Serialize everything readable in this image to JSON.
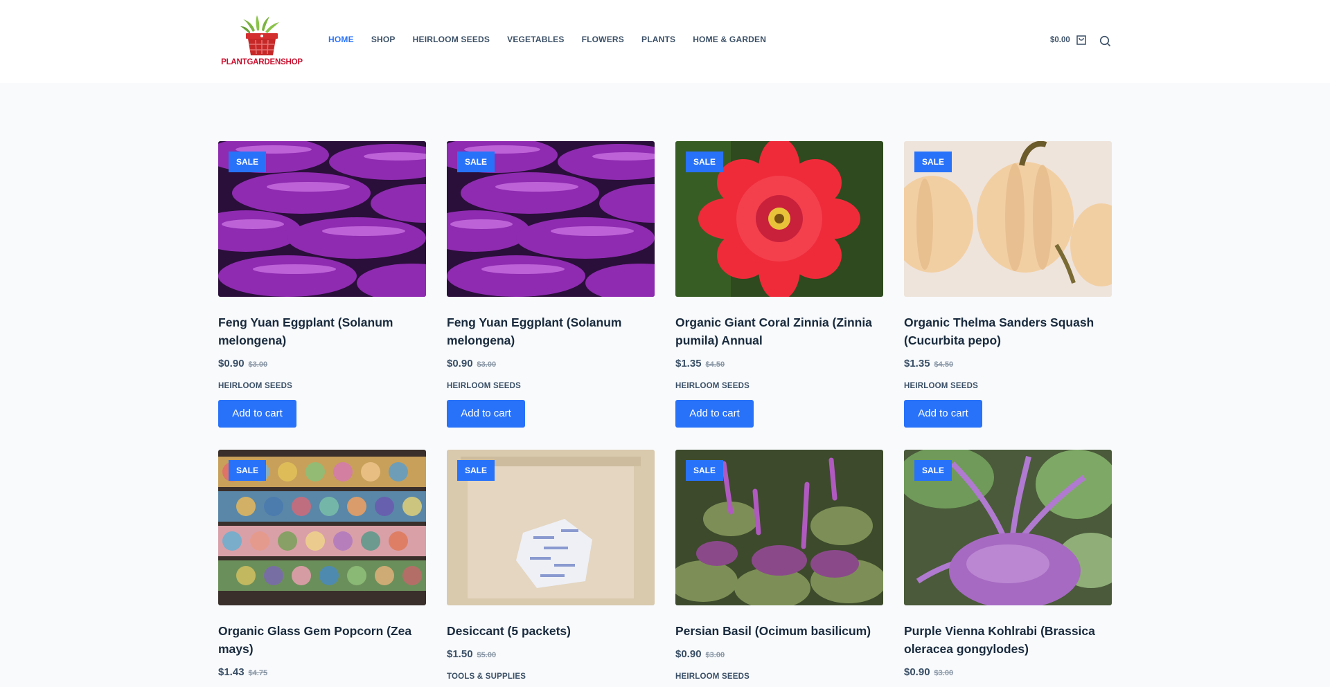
{
  "brand": {
    "name": "PLANTGARDENSHOP"
  },
  "nav": {
    "items": [
      {
        "label": "HOME",
        "active": true
      },
      {
        "label": "SHOP"
      },
      {
        "label": "HEIRLOOM SEEDS"
      },
      {
        "label": "VEGETABLES"
      },
      {
        "label": "FLOWERS"
      },
      {
        "label": "PLANTS"
      },
      {
        "label": "HOME & GARDEN"
      }
    ]
  },
  "header": {
    "cart_total": "$0.00",
    "cart_icon": "cart-icon",
    "search_icon": "search-icon"
  },
  "colors": {
    "accent": "#2872fa",
    "text": "#192a3d",
    "muted": "#3a4f66",
    "page_bg": "#f8fafc"
  },
  "products": [
    {
      "badge": "SALE",
      "title": "Feng Yuan Eggplant (Solanum melongena)",
      "price": "$0.90",
      "old_price": "$3.00",
      "category": "HEIRLOOM SEEDS",
      "button": "Add to cart"
    },
    {
      "badge": "SALE",
      "title": "Feng Yuan Eggplant (Solanum melongena)",
      "price": "$0.90",
      "old_price": "$3.00",
      "category": "HEIRLOOM SEEDS",
      "button": "Add to cart"
    },
    {
      "badge": "SALE",
      "title": "Organic Giant Coral Zinnia (Zinnia pumila) Annual",
      "price": "$1.35",
      "old_price": "$4.50",
      "category": "HEIRLOOM SEEDS",
      "button": "Add to cart"
    },
    {
      "badge": "SALE",
      "title": "Organic Thelma Sanders Squash (Cucurbita pepo)",
      "price": "$1.35",
      "old_price": "$4.50",
      "category": "HEIRLOOM SEEDS",
      "button": "Add to cart"
    },
    {
      "badge": "SALE",
      "title": "Organic Glass Gem Popcorn (Zea mays)",
      "price": "$1.43",
      "old_price": "$4.75",
      "category": "",
      "button": ""
    },
    {
      "badge": "SALE",
      "title": "Desiccant (5 packets)",
      "price": "$1.50",
      "old_price": "$5.00",
      "category": "TOOLS & SUPPLIES",
      "button": ""
    },
    {
      "badge": "SALE",
      "title": "Persian Basil (Ocimum basilicum)",
      "price": "$0.90",
      "old_price": "$3.00",
      "category": "HEIRLOOM SEEDS",
      "button": ""
    },
    {
      "badge": "SALE",
      "title": "Purple Vienna Kohlrabi (Brassica oleracea gongylodes)",
      "price": "$0.90",
      "old_price": "$3.00",
      "category": "",
      "button": ""
    }
  ]
}
